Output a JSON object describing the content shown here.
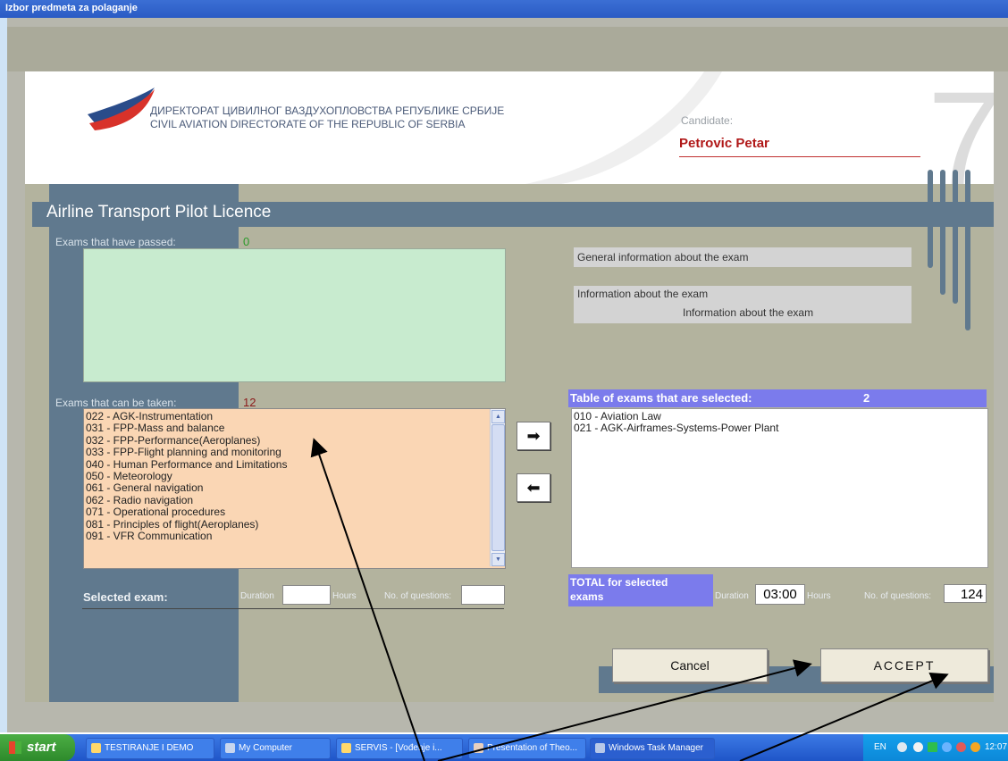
{
  "window": {
    "title": "Izbor predmeta za polaganje"
  },
  "header": {
    "org_line1": "ДИРЕКТОРАТ ЦИВИЛНОГ ВАЗДУХОПЛОВСТВА РЕПУБЛИКЕ СРБИЈЕ",
    "org_line2": "CIVIL AVIATION DIRECTORATE OF THE REPUBLIC OF SERBIA",
    "candidate_label": "Candidate:",
    "candidate_name": "Petrovic Petar",
    "big_digit": "7"
  },
  "licence_title": "Airline Transport Pilot Licence",
  "passed": {
    "label": "Exams that have passed:",
    "count": "0",
    "count_color": "#2a9a2a"
  },
  "available": {
    "label": "Exams that can be taken:",
    "count": "12",
    "count_color": "#8b1a1a",
    "items": [
      "022 - AGK-Instrumentation",
      "031 - FPP-Mass and balance",
      "032 - FPP-Performance(Aeroplanes)",
      "033 - FPP-Flight planning and monitoring",
      "040 - Human Performance and Limitations",
      "050 - Meteorology",
      "061 - General navigation",
      "062 - Radio navigation",
      "071 - Operational procedures",
      "081 - Principles of flight(Aeroplanes)",
      "091 - VFR Communication"
    ]
  },
  "info": {
    "general": "General information about the exam",
    "exam_label": "Information about the exam",
    "exam_value": "Information about the exam"
  },
  "selected": {
    "header": "Table of exams that are selected:",
    "count": "2",
    "items": [
      "010 - Aviation Law",
      "021 - AGK-Airframes-Systems-Power Plant"
    ]
  },
  "selected_exam": {
    "label": "Selected exam:",
    "duration_label": "Duration",
    "duration_value": "",
    "hours_label": "Hours",
    "questions_label": "No. of questions:",
    "questions_value": ""
  },
  "total": {
    "label_line1": "TOTAL for selected",
    "label_line2": "exams",
    "duration_label": "Duration",
    "duration_value": "03:00",
    "hours_label": "Hours",
    "questions_label": "No. of questions:",
    "questions_value": "124"
  },
  "buttons": {
    "cancel": "Cancel",
    "accept": "ACCEPT"
  },
  "taskbar": {
    "start": "start",
    "tasks": [
      "TESTIRANJE I DEMO",
      "My Computer",
      "SERVIS - [Vođenje i...",
      "Presentation of Theo...",
      "Windows Task Manager"
    ],
    "lang": "EN",
    "clock": "12:07"
  },
  "colors": {
    "panel": "#60798e",
    "background": "#b3b39e",
    "selected_header": "#7b7bec",
    "available_bg": "#fad6b4",
    "passed_bg": "#c8ebcf"
  }
}
